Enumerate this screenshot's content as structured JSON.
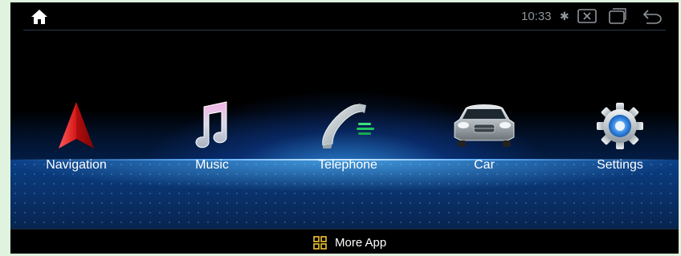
{
  "status_bar": {
    "time": "10:33",
    "icons": [
      "home-icon",
      "bluetooth-icon",
      "close-box-icon",
      "recent-apps-icon",
      "back-icon"
    ]
  },
  "apps": [
    {
      "label": "Navigation",
      "icon": "navigation-arrow-icon"
    },
    {
      "label": "Music",
      "icon": "music-note-icon"
    },
    {
      "label": "Telephone",
      "icon": "phone-handset-icon"
    },
    {
      "label": "Car",
      "icon": "car-icon"
    },
    {
      "label": "Settings",
      "icon": "gear-icon"
    }
  ],
  "bottom_bar": {
    "more_app_label": "More App",
    "icon": "app-grid-icon"
  },
  "colors": {
    "accent_blue": "#3aa8ff",
    "grid_icon": "#f1c232",
    "status_text": "#8f969c"
  }
}
